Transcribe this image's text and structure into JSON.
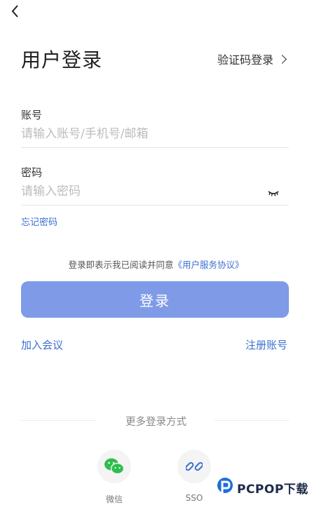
{
  "header": {
    "back_icon": "chevron-left-icon"
  },
  "title": "用户登录",
  "sms_login_label": "验证码登录",
  "account": {
    "label": "账号",
    "placeholder": "请输入账号/手机号/邮箱",
    "value": ""
  },
  "password": {
    "label": "密码",
    "placeholder": "请输入密码",
    "value": "",
    "visibility_icon": "eye-closed-icon"
  },
  "forgot_label": "忘记密码",
  "agreement": {
    "text": "登录即表示我已阅读并同意",
    "link": "《用户服务协议》"
  },
  "login_button": "登录",
  "join_meeting": "加入会议",
  "register": "注册账号",
  "more_login": "更多登录方式",
  "social": [
    {
      "label": "微信",
      "icon": "wechat-icon",
      "color": "#2dbe4e"
    },
    {
      "label": "SSO",
      "icon": "link-icon",
      "color": "#3c6fd1"
    }
  ],
  "colors": {
    "accent": "#3c6fd1",
    "button": "#7f9be8"
  }
}
